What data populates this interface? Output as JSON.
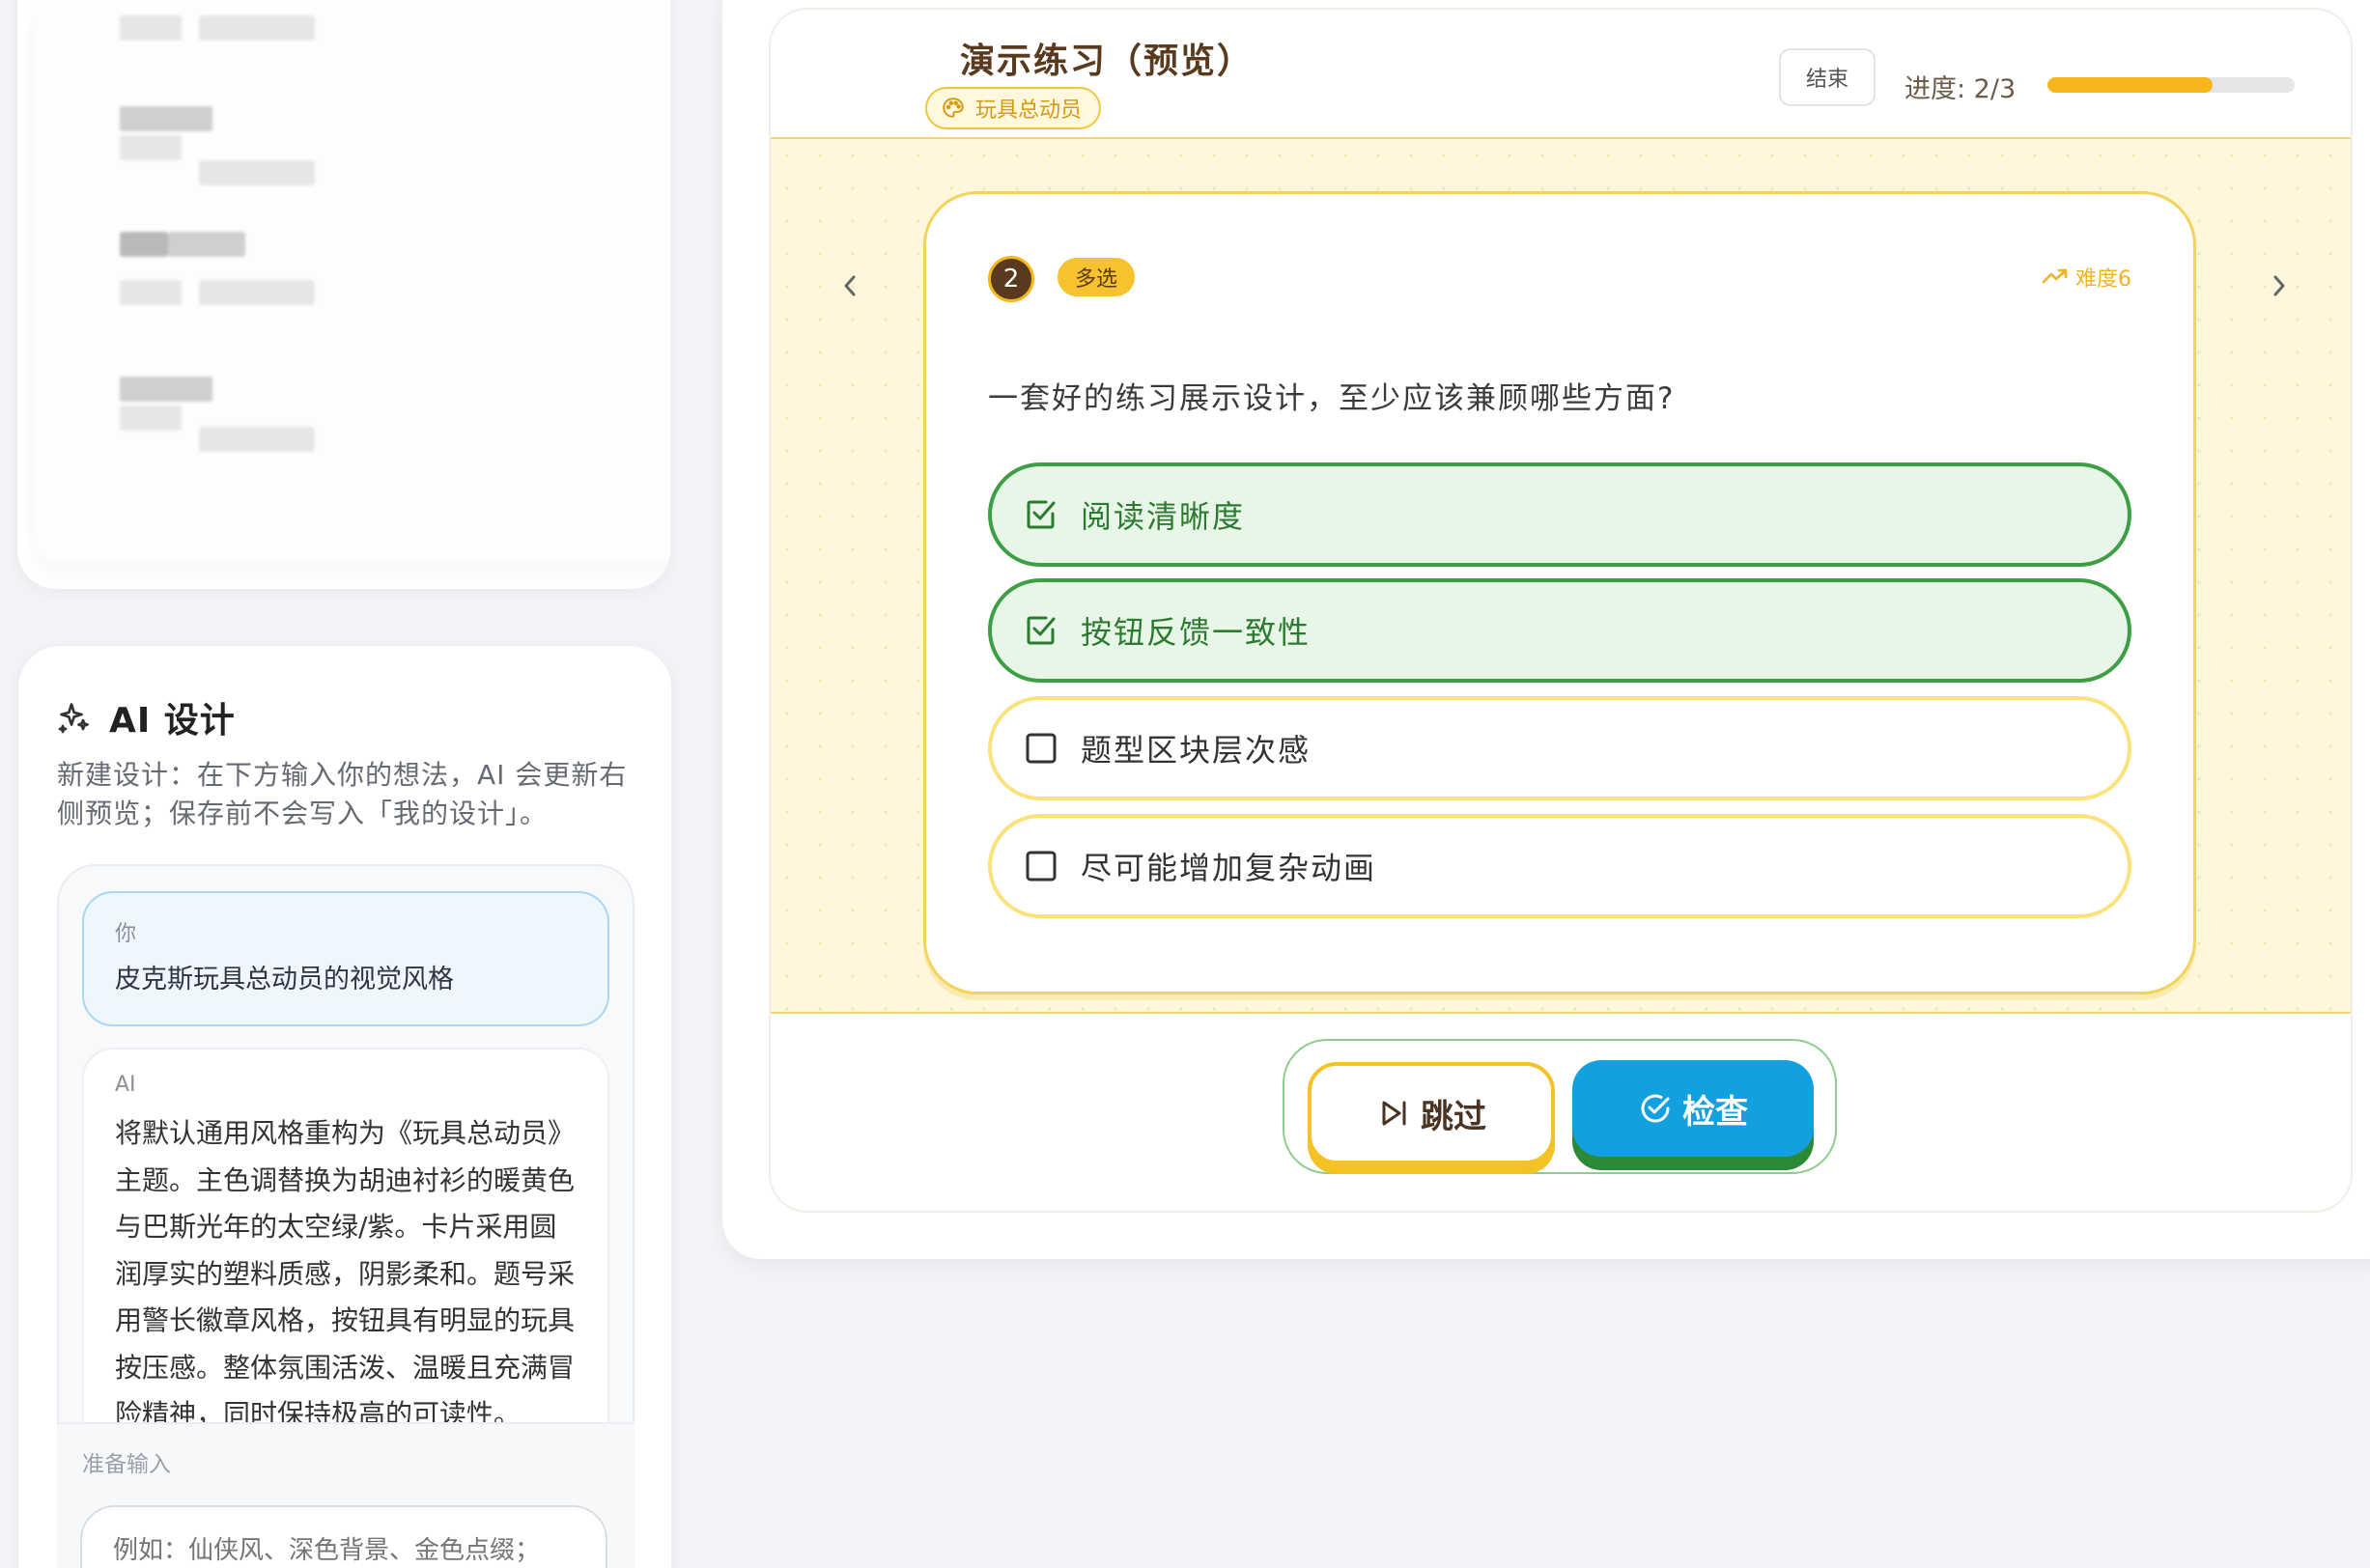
{
  "sidebar": {
    "ai_panel": {
      "title": "AI 设计",
      "description": "新建设计：在下方输入你的想法，AI 会更新右侧预览；保存前不会写入「我的设计」。",
      "messages": [
        {
          "role": "你",
          "text": "皮克斯玩具总动员的视觉风格"
        },
        {
          "role": "AI",
          "text": "将默认通用风格重构为《玩具总动员》主题。主色调替换为胡迪衬衫的暖黄色与巴斯光年的太空绿/紫。卡片采用圆润厚实的塑料质感，阴影柔和。题号采用警长徽章风格，按钮具有明显的玩具按压感。整体氛围活泼、温暖且充满冒险精神，同时保持极高的可读性。"
        }
      ],
      "input_label": "准备输入",
      "input_placeholder": "例如：仙侠风、深色背景、金色点缀；"
    }
  },
  "preview": {
    "title": "演示练习（预览）",
    "theme_tag": "玩具总动员",
    "end_label": "结束",
    "progress_text": "进度: 2/3",
    "progress_fraction": 0.667,
    "question": {
      "number": "2",
      "type_label": "多选",
      "difficulty_label": "难度6",
      "text": "一套好的练习展示设计，至少应该兼顾哪些方面?",
      "options": [
        {
          "label": "阅读清晰度",
          "selected": true
        },
        {
          "label": "按钮反馈一致性",
          "selected": true
        },
        {
          "label": "题型区块层次感",
          "selected": false
        },
        {
          "label": "尽可能增加复杂动画",
          "selected": false
        }
      ]
    },
    "actions": {
      "skip_label": "跳过",
      "check_label": "检查"
    }
  },
  "colors": {
    "accent_yellow": "#f6b71d",
    "selected_green": "#3e9e45",
    "check_blue": "#13a0df",
    "brown": "#5a3a1e"
  }
}
